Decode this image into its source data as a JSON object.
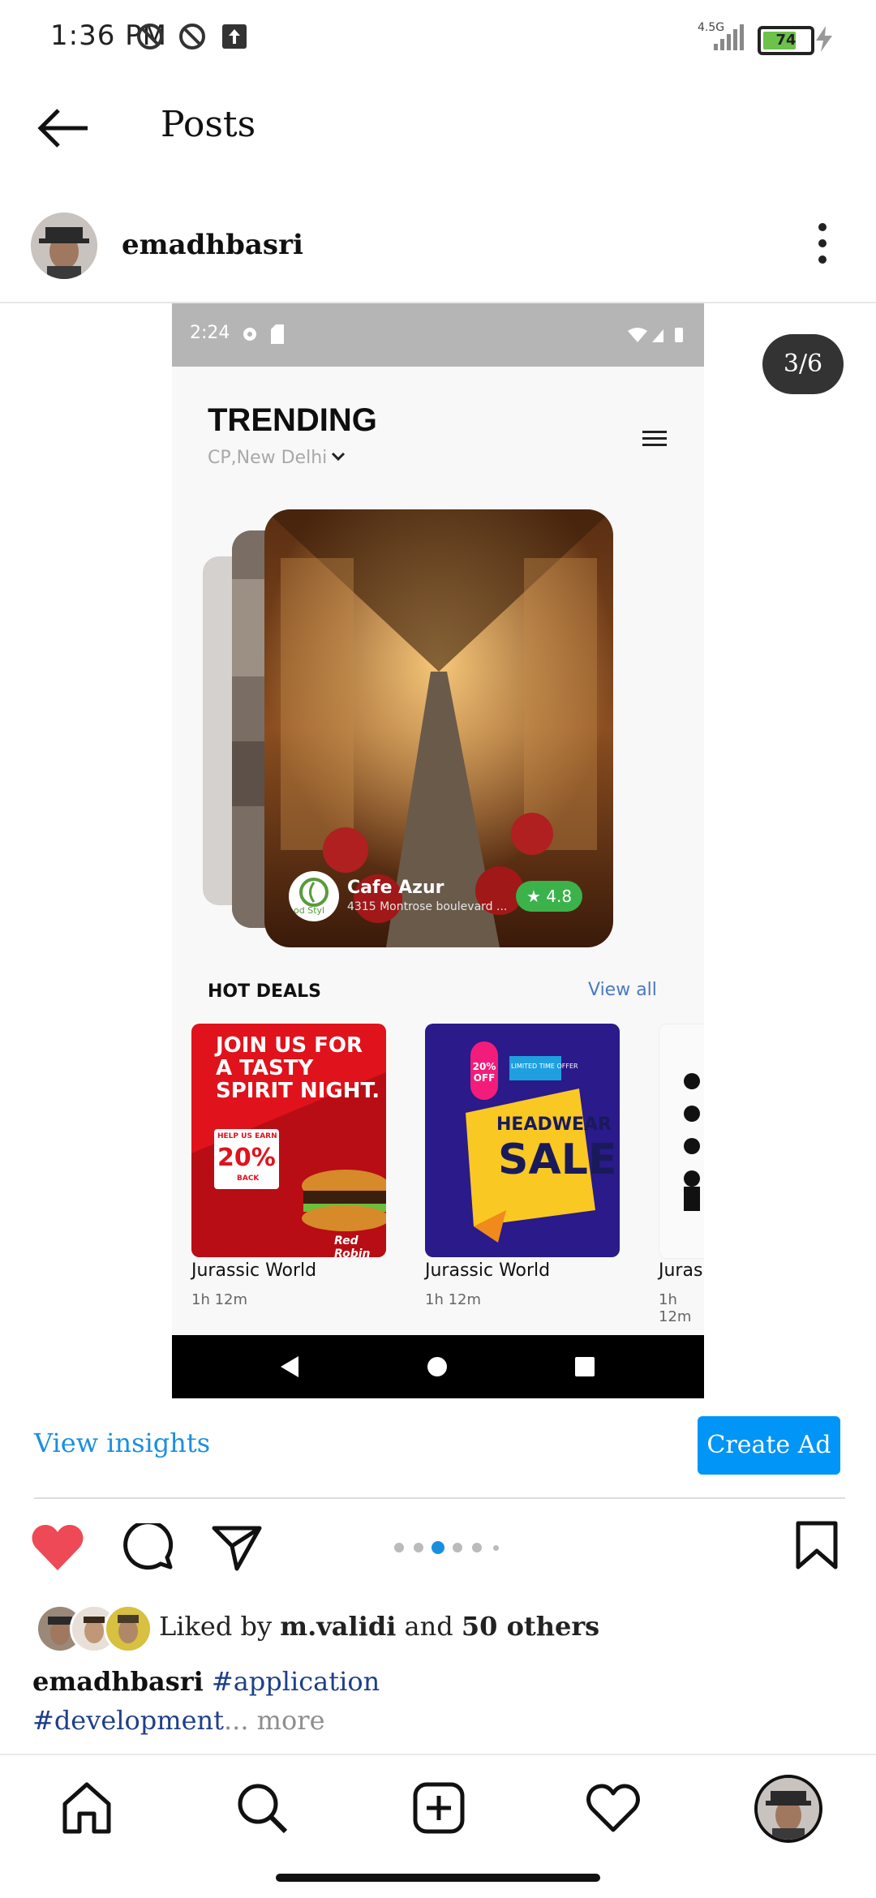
{
  "status_bar": {
    "time": "1:36 PM",
    "network": "4.5G",
    "battery": "74"
  },
  "header": {
    "title": "Posts"
  },
  "post_author": {
    "username": "emadhbasri"
  },
  "page_indicator": "3/6",
  "screenshot": {
    "time": "2:24",
    "heading": "TRENDING",
    "location": "CP,New Delhi",
    "featured": {
      "name": "Cafe Azur",
      "address": "4315 Montrose boulevard ...",
      "rating": "4.8",
      "logo_text": "od Styl"
    },
    "hot_deals_label": "HOT DEALS",
    "view_all": "View all",
    "deals": [
      {
        "title": "Jurassic World",
        "duration": "1h 12m",
        "ad_line1": "JOIN US FOR",
        "ad_line2": "A TASTY",
        "ad_line3": "SPIRIT NIGHT.",
        "ad_badge_top": "HELP US EARN",
        "ad_badge_value": "20%",
        "ad_badge_bottom": "BACK",
        "ad_brand": "Red Robin"
      },
      {
        "title": "Jurassic World",
        "duration": "1h 12m",
        "ad_tag": "20% OFF",
        "ad_offer": "LIMITED TIME OFFER",
        "ad_line1": "HEADWEAR",
        "ad_line2": "SALE"
      },
      {
        "title": "Juras",
        "duration": "1h 12m"
      }
    ]
  },
  "actions": {
    "view_insights": "View insights",
    "create_ad": "Create Ad"
  },
  "likes": {
    "prefix": "Liked by ",
    "user": "m.validi",
    "middle": " and ",
    "count": "50",
    "suffix": " others"
  },
  "caption": {
    "username": "emadhbasri",
    "tag1": "#application",
    "tag2": "#development",
    "more": "... more"
  },
  "colors": {
    "accent": "#0095f6",
    "like": "#ed4956",
    "rating": "#3bb24a",
    "view_all": "#4a78c4"
  }
}
